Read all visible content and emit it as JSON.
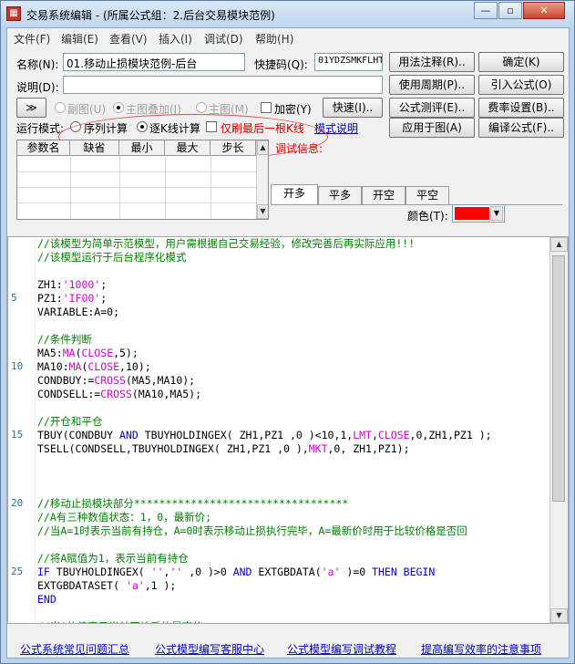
{
  "window": {
    "title": "交易系统编辑 - (所属公式组：2.后台交易模块范例)",
    "app_icon": "grid-app-icon",
    "minimize_glyph": "—",
    "restore_glyph": "▫",
    "close_glyph": "✕"
  },
  "menu": [
    "文件(F)",
    "编辑(E)",
    "查看(V)",
    "插入(I)",
    "调试(D)",
    "帮助(H)"
  ],
  "form": {
    "name_label": "名称(N):",
    "name_value": "01.移动止损模块范例-后台",
    "shortcut_label": "快捷码(Q):",
    "shortcut_value": "01YDZSMKFLHT",
    "desc_label": "说明(D):",
    "desc_value": "",
    "expand_button": "≫",
    "subchart_radio": "副图(U)",
    "overlay_radio": "主图叠加(J)",
    "mainchart_radio": "主图(M)",
    "encrypt_checkbox": "加密(Y)",
    "quick_button": "快速(I)..",
    "run_mode_label": "运行模式:",
    "run_sequential": "序列计算",
    "run_tick": "逐K线计算",
    "refresh_last_label": "仅刷最后一根K线",
    "mode_help_link": "模式说明",
    "debug_info_label": "调试信息:"
  },
  "right_buttons": [
    [
      "用法注释(R)..",
      "确定(K)"
    ],
    [
      "使用周期(P)..",
      "引入公式(O)"
    ],
    [
      "公式测评(E)..",
      "费率设置(B).."
    ],
    [
      "应用于图(A)",
      "编译公式(F).."
    ]
  ],
  "param_table": {
    "headers": [
      "参数名",
      "缺省",
      "最小",
      "最大",
      "步长"
    ]
  },
  "trade_tabs": [
    "开多",
    "平多",
    "开空",
    "平空"
  ],
  "color": {
    "label": "颜色(T):",
    "value": "#ff0000"
  },
  "code": {
    "line_numbers": [
      "5",
      "10",
      "15",
      "20",
      "25"
    ],
    "lines": [
      [
        [
          "cm",
          "//该模型为简单示范模型，用户需根据自己交易经验，修改完善后再实际应用!!!"
        ]
      ],
      [
        [
          "cm",
          "//该模型运行于后台程序化模式"
        ]
      ],
      [
        [
          "",
          ""
        ]
      ],
      [
        [
          "",
          "ZH1:"
        ],
        [
          "str",
          "'1000'"
        ],
        [
          "",
          ";"
        ]
      ],
      [
        [
          "",
          "PZ1:"
        ],
        [
          "str",
          "'IF00'"
        ],
        [
          "",
          ";"
        ]
      ],
      [
        [
          "",
          "VARIABLE:A=0;"
        ]
      ],
      [
        [
          "",
          ""
        ]
      ],
      [
        [
          "cm",
          "//条件判断"
        ]
      ],
      [
        [
          "",
          "MA5:"
        ],
        [
          "fn",
          "MA"
        ],
        [
          "",
          "("
        ],
        [
          "fn",
          "CLOSE"
        ],
        [
          "",
          ",5);"
        ]
      ],
      [
        [
          "",
          "MA10:"
        ],
        [
          "fn",
          "MA"
        ],
        [
          "",
          "("
        ],
        [
          "fn",
          "CLOSE"
        ],
        [
          "",
          ",10);"
        ]
      ],
      [
        [
          "",
          "CONDBUY:="
        ],
        [
          "fn",
          "CROSS"
        ],
        [
          "",
          "(MA5,MA10);"
        ]
      ],
      [
        [
          "",
          "CONDSELL:="
        ],
        [
          "fn",
          "CROSS"
        ],
        [
          "",
          "(MA10,MA5);"
        ]
      ],
      [
        [
          "",
          ""
        ]
      ],
      [
        [
          "cm",
          "//开仓和平仓"
        ]
      ],
      [
        [
          "",
          "TBUY(CONDBUY "
        ],
        [
          "kw",
          "AND"
        ],
        [
          "",
          " TBUYHOLDINGEX( ZH1,PZ1 ,0 )<10,1,"
        ],
        [
          "fn",
          "LMT"
        ],
        [
          "",
          ","
        ],
        [
          "fn",
          "CLOSE"
        ],
        [
          "",
          ",0,ZH1,PZ1 );"
        ]
      ],
      [
        [
          "",
          "TSELL(CONDSELL,TBUYHOLDINGEX( ZH1,PZ1 ,0 ),"
        ],
        [
          "fn",
          "MKT"
        ],
        [
          "",
          ",0, ZH1,PZ1);"
        ]
      ],
      [
        [
          "",
          ""
        ]
      ],
      [
        [
          "",
          ""
        ]
      ],
      [
        [
          "",
          ""
        ]
      ],
      [
        [
          "cm",
          "//移动止损模块部分**********************************"
        ]
      ],
      [
        [
          "cm",
          "//A有三种数值状态：1，0，最新价;"
        ]
      ],
      [
        [
          "cm",
          "//当A=1时表示当前有持仓，A=0时表示移动止损执行完毕，A=最新价时用于比较价格是否回"
        ]
      ],
      [
        [
          "",
          ""
        ]
      ],
      [
        [
          "cm",
          "//将A赋值为1，表示当前有持仓"
        ]
      ],
      [
        [
          "kw",
          "IF"
        ],
        [
          "",
          " TBUYHOLDINGEX( "
        ],
        [
          "str",
          "''"
        ],
        [
          "",
          ","
        ],
        [
          "str",
          "''"
        ],
        [
          "",
          " ,0 )>0 "
        ],
        [
          "kw",
          "AND"
        ],
        [
          "",
          " EXTGBDATA("
        ],
        [
          "str",
          "'a'"
        ],
        [
          "",
          " )=0 "
        ],
        [
          "kw",
          "THEN BEGIN"
        ]
      ],
      [
        [
          "",
          "EXTGBDATASET( "
        ],
        [
          "str",
          "'a'"
        ],
        [
          "",
          ",1 );"
        ]
      ],
      [
        [
          "kw",
          "END"
        ]
      ],
      [
        [
          "",
          ""
        ]
      ],
      [
        [
          "cm",
          "//当A的值表示当前开始后的最高价"
        ]
      ]
    ]
  },
  "footer_links": [
    "公式系统常见问题汇总",
    "公式模型编写客服中心",
    "公式模型编写调试教程",
    "提高编写效率的注意事项"
  ]
}
